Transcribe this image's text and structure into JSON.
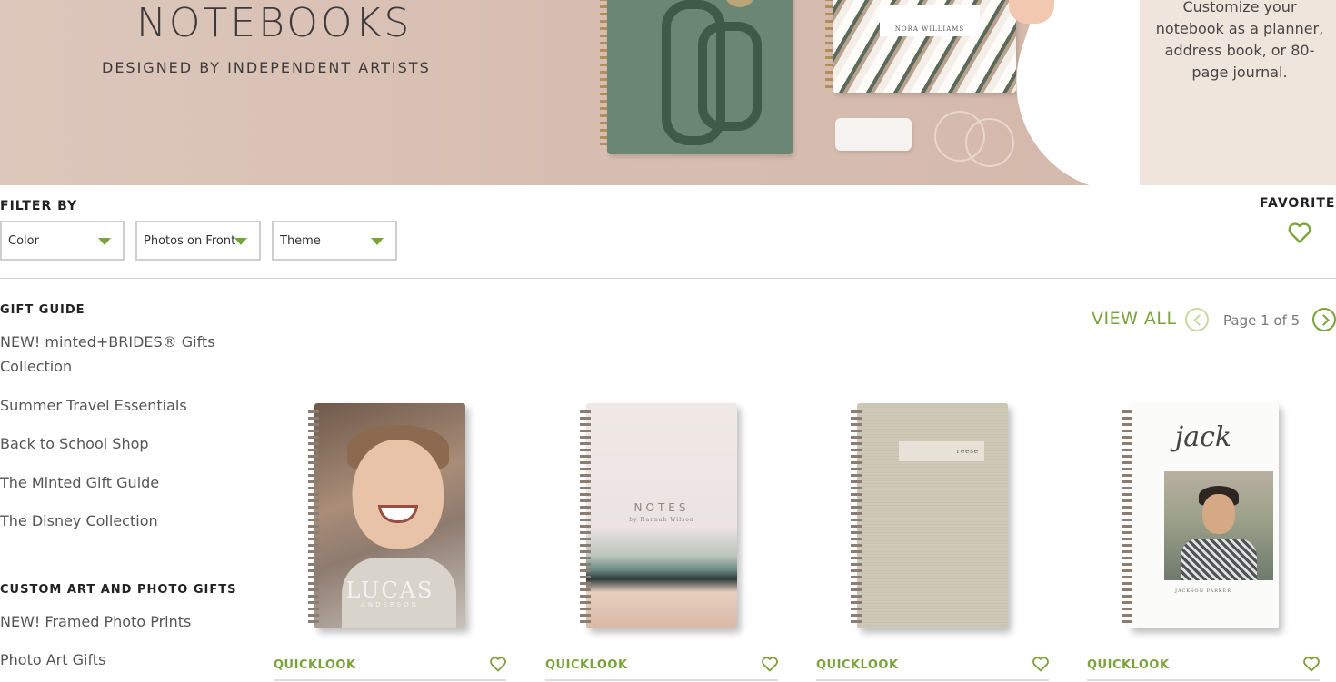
{
  "hero": {
    "title": "NOTEBOOKS",
    "subtitle": "DESIGNED BY INDEPENDENT ARTISTS",
    "side_copy": "Customize your notebook as a planner, address book, or 80-page journal.",
    "notebook_label": "NORA WILLIAMS"
  },
  "filter": {
    "label": "FILTER BY",
    "dropdowns": [
      {
        "value": "Color"
      },
      {
        "value": "Photos on Front"
      },
      {
        "value": "Theme"
      }
    ]
  },
  "favorites": {
    "label": "FAVORITES"
  },
  "sidebar": {
    "sections": [
      {
        "title": "GIFT GUIDE",
        "items": [
          {
            "label": "NEW! minted+BRIDES® Gifts Collection"
          },
          {
            "label": "Summer Travel Essentials"
          },
          {
            "label": "Back to School Shop"
          },
          {
            "label": "The Minted Gift Guide"
          },
          {
            "label": "The Disney Collection"
          }
        ]
      },
      {
        "title": "CUSTOM ART AND PHOTO GIFTS",
        "items": [
          {
            "label": "NEW! Framed Photo Prints"
          },
          {
            "label": "Photo Art Gifts"
          }
        ]
      }
    ]
  },
  "pager": {
    "view_all": "VIEW ALL",
    "page_text": "Page 1 of 5"
  },
  "products": [
    {
      "quicklook": "QUICKLOOK",
      "cover_name": "LUCAS",
      "cover_sub": "ANDERSON"
    },
    {
      "quicklook": "QUICKLOOK",
      "cover_name": "NOTES",
      "cover_sub": "by Hannah Wilson"
    },
    {
      "quicklook": "QUICKLOOK",
      "cover_name": "reese"
    },
    {
      "quicklook": "QUICKLOOK",
      "cover_name": "jack",
      "cover_sub": "JACKSON PARKER"
    }
  ],
  "colors": {
    "accent": "#7aa33b",
    "hero_bg": "#d9bfb3",
    "hero_side_bg": "#f0e5dd",
    "text_dark": "#222222",
    "text_muted": "#555555"
  },
  "icons": [
    "chevron-down-icon",
    "heart-icon",
    "chevron-left-icon",
    "chevron-right-icon"
  ]
}
